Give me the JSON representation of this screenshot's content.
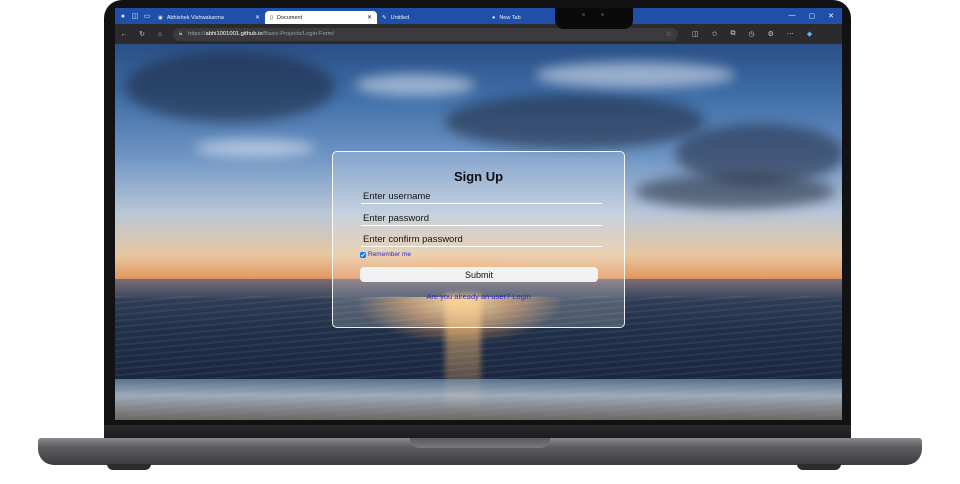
{
  "browser": {
    "tabs": [
      {
        "label": "Abhishek Vishwakarma",
        "close": "✕"
      },
      {
        "label": "Document",
        "close": "✕",
        "active": true
      },
      {
        "label": "Untitled",
        "close": ""
      },
      {
        "label": "New Tab",
        "close": "✕"
      }
    ],
    "new_tab": "+",
    "url_host": "abhi1001001.github.io",
    "url_prefix": "https://",
    "url_path": "/Basic-Projects/Login-Form/",
    "icons": [
      "back-icon",
      "refresh-icon",
      "home-icon",
      "lock-icon",
      "star-icon",
      "split-screen-icon",
      "favorites-icon",
      "collections-icon",
      "history-icon",
      "extensions-icon",
      "more-icon",
      "copilot-icon"
    ],
    "window_controls": [
      "—",
      "▢",
      "✕"
    ]
  },
  "form": {
    "title": "Sign Up",
    "username_placeholder": "Enter username",
    "password_placeholder": "Enter password",
    "confirm_placeholder": "Enter confirm password",
    "remember_label": "Remember me",
    "remember_checked": true,
    "submit_label": "Submit",
    "login_prompt": "Are you already an user? Login"
  },
  "colors": {
    "tab_bar": "#1f4fa8",
    "address_bar": "#2b2b2d",
    "link": "#2a2ad6"
  }
}
